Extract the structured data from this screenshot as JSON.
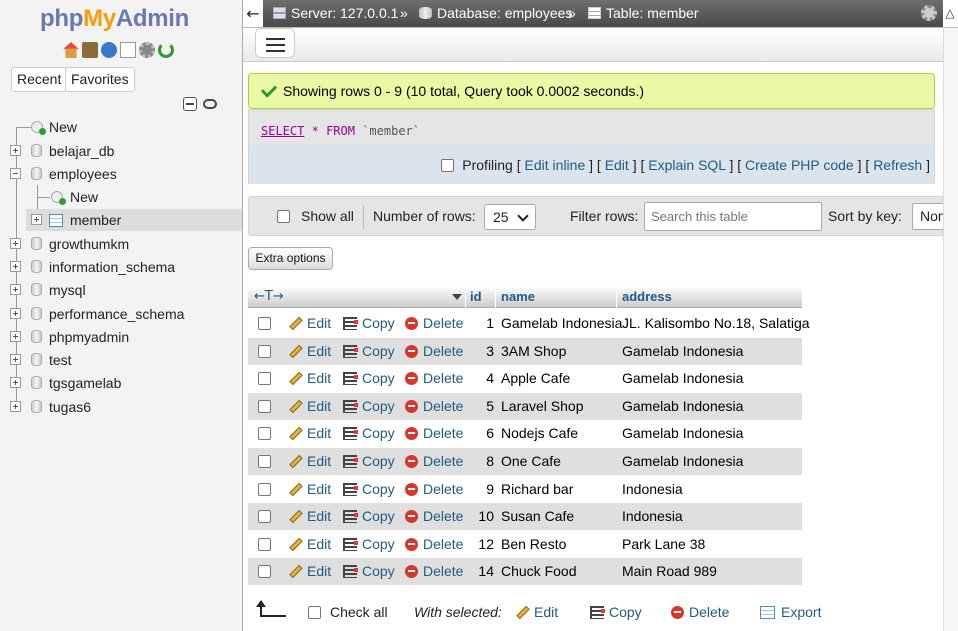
{
  "sidebar": {
    "logo": {
      "php": "php",
      "my": "My",
      "admin": "Admin"
    },
    "tabs": {
      "recent": "Recent",
      "favorites": "Favorites"
    },
    "tree": {
      "new": "New",
      "databases": [
        "belajar_db",
        "employees",
        "growthumkm",
        "information_schema",
        "mysql",
        "performance_schema",
        "phpmyadmin",
        "test",
        "tgsgamelab",
        "tugas6"
      ],
      "employees_children": {
        "new": "New",
        "member": "member"
      }
    }
  },
  "topbar": {
    "server": "Server: 127.0.0.1",
    "database": "Database: employees",
    "table": "Table: member",
    "separator": "»"
  },
  "message": {
    "success": "Showing rows 0 - 9 (10 total, Query took 0.0002 seconds.)"
  },
  "sql": {
    "kw_select": "SELECT",
    "star": "*",
    "kw_from": "FROM",
    "table": "`member`",
    "profiling": "Profiling",
    "links": [
      "Edit inline",
      "Edit",
      "Explain SQL",
      "Create PHP code",
      "Refresh"
    ]
  },
  "navigation": {
    "show_all": "Show all",
    "number_of_rows_label": "Number of rows:",
    "number_of_rows_value": "25",
    "filter_rows_label": "Filter rows:",
    "filter_placeholder": "Search this table",
    "sort_by_key_label": "Sort by key:",
    "sort_by_key_value": "None"
  },
  "extra_options": "Extra options",
  "table": {
    "columns": [
      "id",
      "name",
      "address"
    ],
    "actions": {
      "edit": "Edit",
      "copy": "Copy",
      "delete": "Delete"
    },
    "rows": [
      {
        "id": "1",
        "name": "Gamelab Indonesia",
        "address": "JL. Kalisombo No.18, Salatiga"
      },
      {
        "id": "3",
        "name": "3AM Shop",
        "address": "Gamelab Indonesia"
      },
      {
        "id": "4",
        "name": "Apple Cafe",
        "address": "Gamelab Indonesia"
      },
      {
        "id": "5",
        "name": "Laravel Shop",
        "address": "Gamelab Indonesia"
      },
      {
        "id": "6",
        "name": "Nodejs Cafe",
        "address": "Gamelab Indonesia"
      },
      {
        "id": "8",
        "name": "One Cafe",
        "address": "Gamelab Indonesia"
      },
      {
        "id": "9",
        "name": "Richard bar",
        "address": "Indonesia"
      },
      {
        "id": "10",
        "name": "Susan Cafe",
        "address": "Indonesia"
      },
      {
        "id": "12",
        "name": "Ben Resto",
        "address": "Park Lane 38"
      },
      {
        "id": "14",
        "name": "Chuck Food",
        "address": "Main Road 989"
      }
    ]
  },
  "bulk": {
    "check_all": "Check all",
    "with_selected": "With selected:",
    "edit": "Edit",
    "copy": "Copy",
    "delete": "Delete",
    "export": "Export"
  }
}
